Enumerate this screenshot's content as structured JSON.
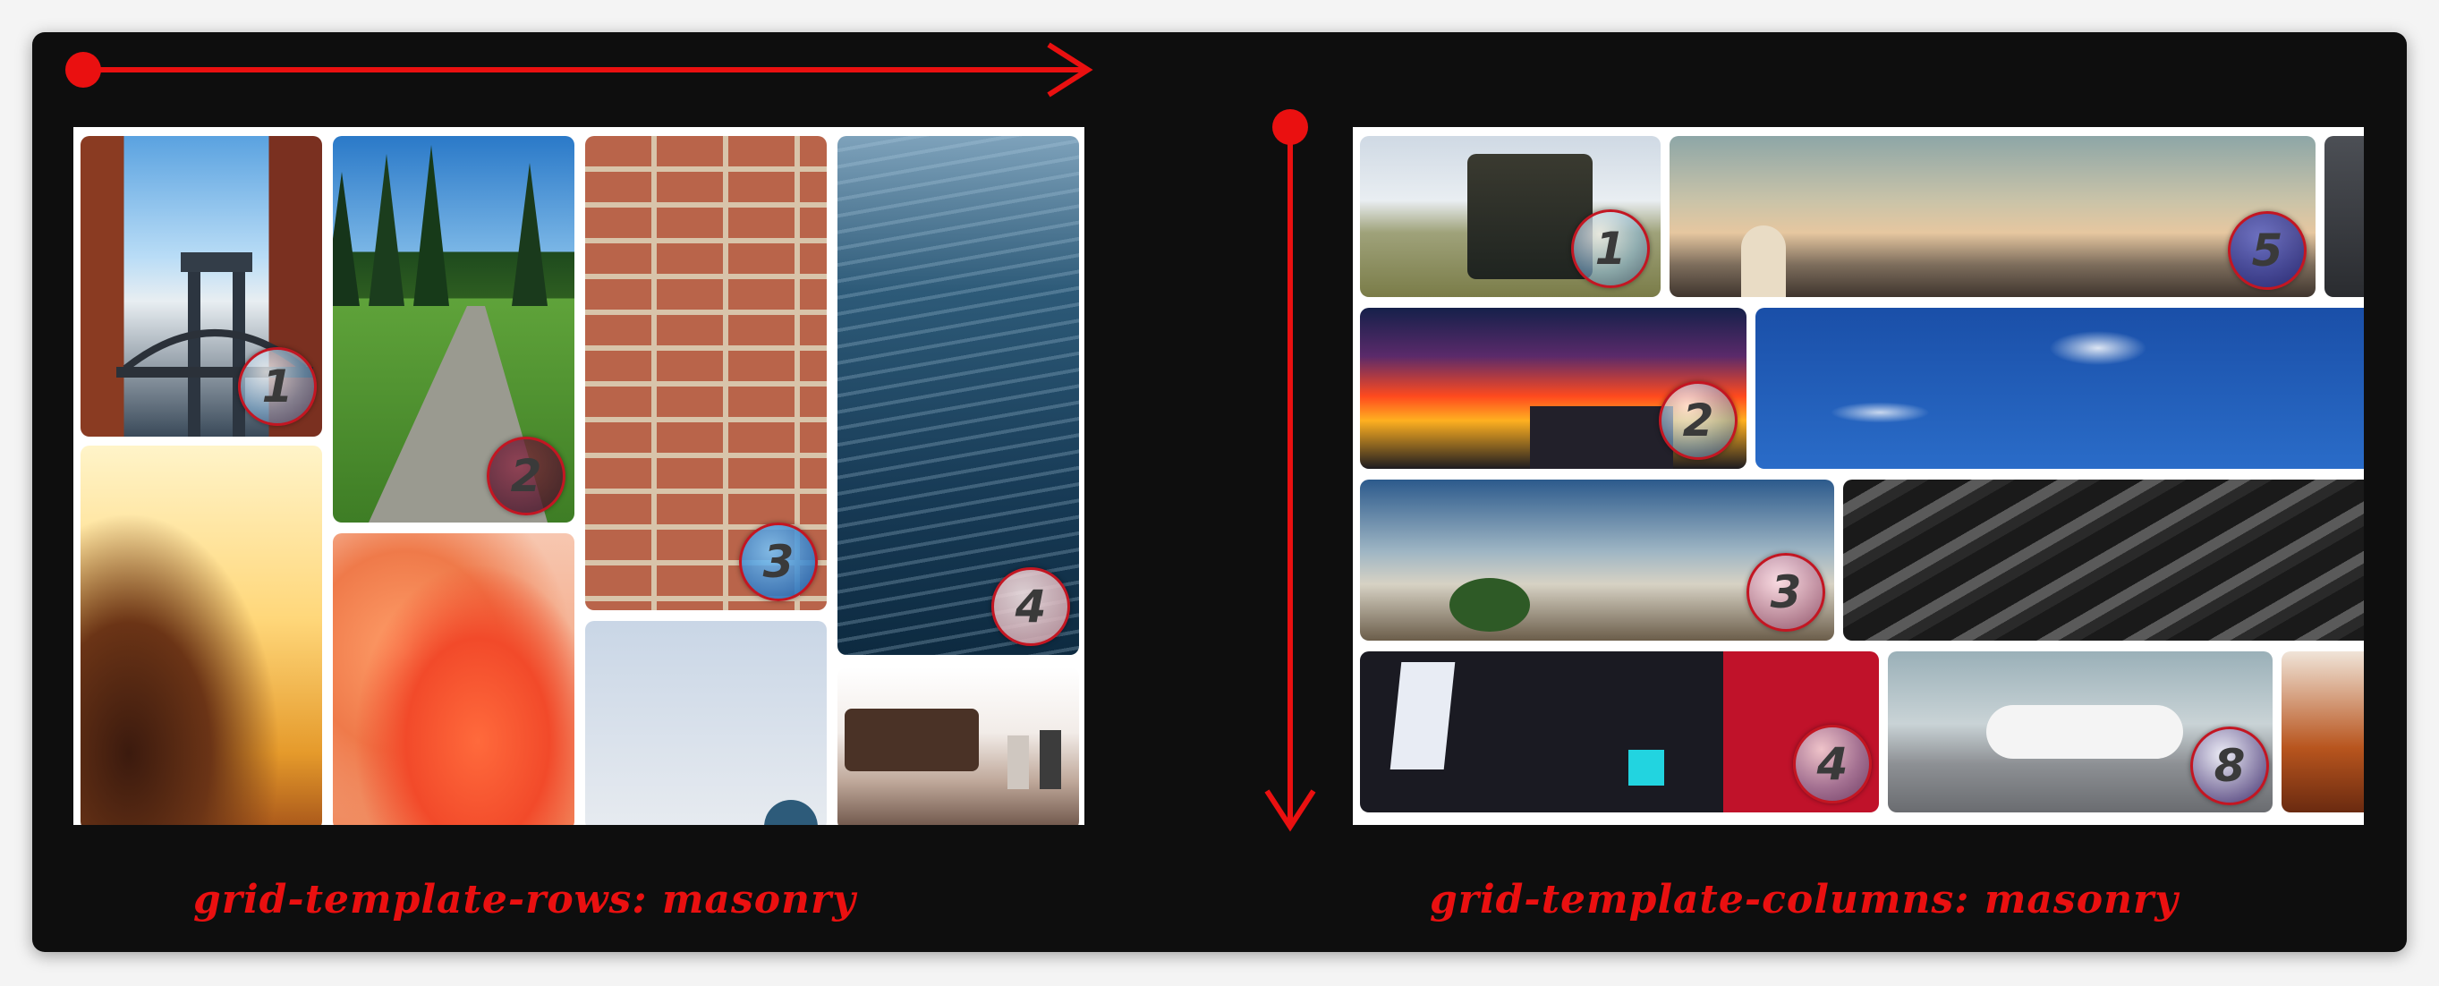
{
  "captions": {
    "left": "grid-template-rows: masonry",
    "right": "grid-template-columns: masonry"
  },
  "colors": {
    "frame": "#0e0e0e",
    "accent": "#ea1010",
    "panel": "#ffffff"
  },
  "left_grid": {
    "badges": [
      "1",
      "2",
      "3",
      "4"
    ],
    "tiles": [
      {
        "name": "bridge-photo",
        "badge": "1"
      },
      {
        "name": "path-in-woods-photo",
        "badge": "2"
      },
      {
        "name": "brick-wall-photo",
        "badge": "3"
      },
      {
        "name": "water-surface-photo",
        "badge": "4"
      },
      {
        "name": "sunlit-hair-photo"
      },
      {
        "name": "orange-flower-photo"
      },
      {
        "name": "pale-sky-photo"
      },
      {
        "name": "cafe-table-photo"
      }
    ]
  },
  "right_grid": {
    "badges": [
      "1",
      "5",
      "2",
      "3",
      "4",
      "8"
    ],
    "tiles": [
      {
        "name": "old-truck-photo",
        "badge": "1"
      },
      {
        "name": "clouds-horizon-photo",
        "badge": "5"
      },
      {
        "name": "sunset-city-photo",
        "badge": "2"
      },
      {
        "name": "blue-sky-photo"
      },
      {
        "name": "mountain-tree-photo",
        "badge": "3"
      },
      {
        "name": "architecture-photo"
      },
      {
        "name": "night-city-photo",
        "badge": "4"
      },
      {
        "name": "airplane-photo",
        "badge": "8"
      }
    ]
  },
  "icons": {
    "horizontal_arrow": "arrow-right-icon",
    "vertical_arrow": "arrow-down-icon"
  }
}
